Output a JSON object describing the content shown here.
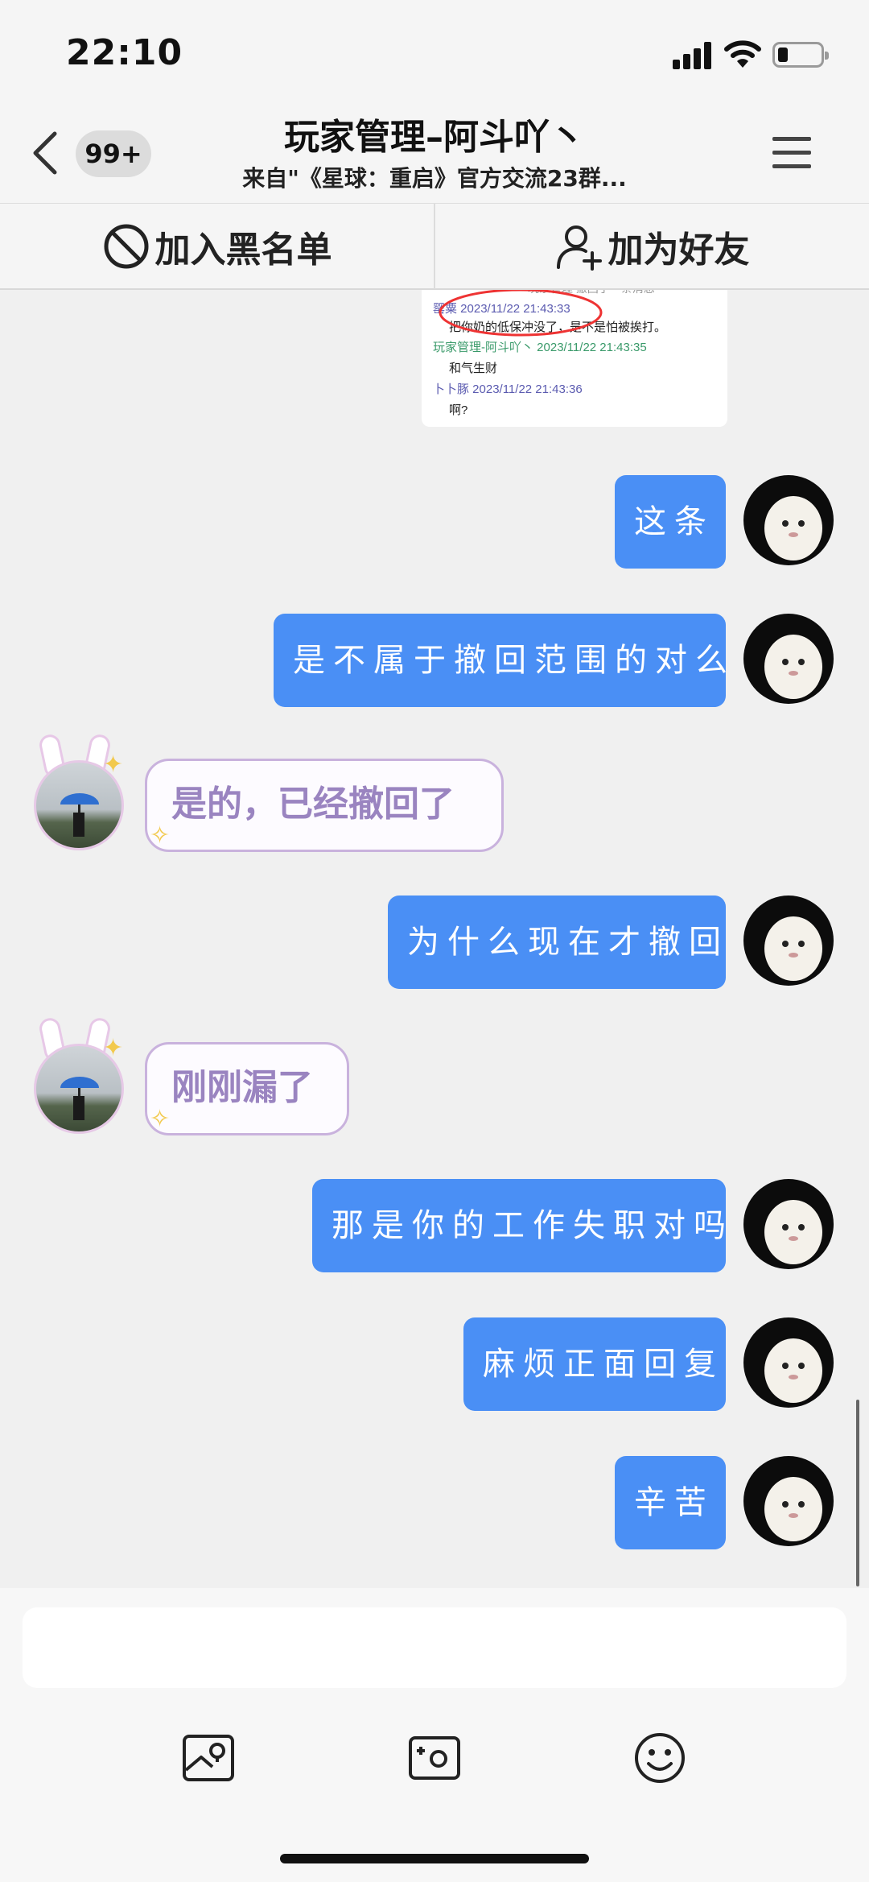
{
  "status_bar": {
    "time": "22:10"
  },
  "header": {
    "badge": "99+",
    "title": "玩家管理–阿斗吖丶",
    "subtitle": "来自\"《星球：重启》官方交流23群..."
  },
  "actions": {
    "blacklist_label": "加入黑名单",
    "add_friend_label": "加为好友"
  },
  "quoted_screenshot": {
    "lines": [
      "—— 玩家管理 撤回了一条消息",
      "罂粟 2023/11/22 21:43:33",
      "把你奶的低保冲没了，是不是怕被挨打。",
      "玩家管理-阿斗吖丶 2023/11/22 21:43:35",
      "和气生财",
      "卜卜豚 2023/11/22 21:43:36",
      "啊?"
    ]
  },
  "messages": [
    {
      "side": "out",
      "text": "这条"
    },
    {
      "side": "out",
      "text": "是不属于撤回范围的对么"
    },
    {
      "side": "in",
      "text": "是的，已经撤回了"
    },
    {
      "side": "out",
      "text": "为什么现在才撤回"
    },
    {
      "side": "in",
      "text": "刚刚漏了"
    },
    {
      "side": "out",
      "text": "那是你的工作失职对吗"
    },
    {
      "side": "out",
      "text": "麻烦正面回复"
    },
    {
      "side": "out",
      "text": "辛苦"
    }
  ],
  "input": {
    "placeholder": ""
  },
  "toolbar": {
    "icons": [
      "image-icon",
      "photo-camera-icon",
      "emoji-icon"
    ]
  },
  "colors": {
    "outgoing_bubble": "#4a8ff5",
    "incoming_text": "#9a84c0",
    "incoming_border": "#c9b2dd"
  }
}
